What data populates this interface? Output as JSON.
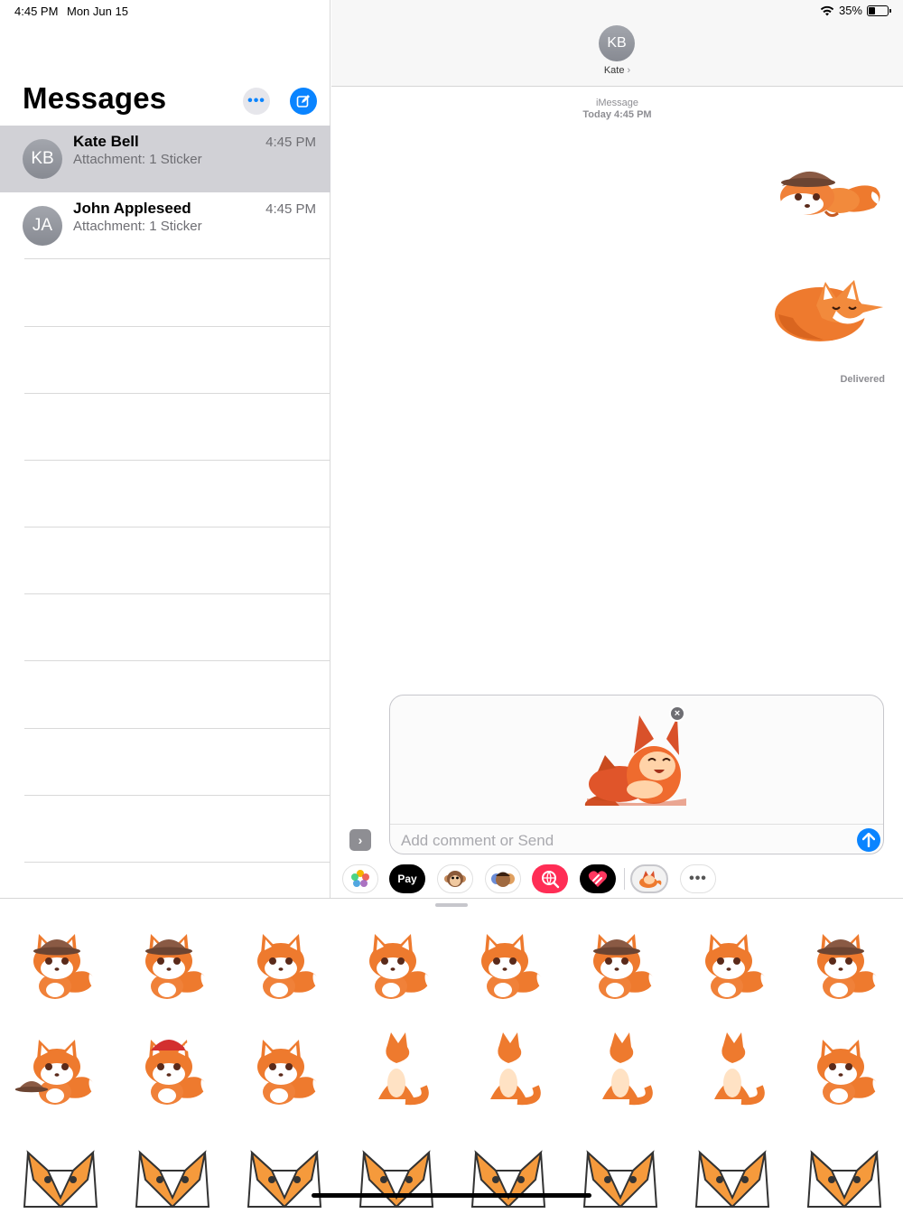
{
  "status": {
    "time": "4:45 PM",
    "date": "Mon Jun 15",
    "battery": "35%",
    "battery_level": 0.35
  },
  "list": {
    "title": "Messages",
    "conversations": [
      {
        "initials": "KB",
        "name": "Kate Bell",
        "preview": "Attachment: 1 Sticker",
        "time": "4:45 PM",
        "selected": true
      },
      {
        "initials": "JA",
        "name": "John Appleseed",
        "preview": "Attachment: 1 Sticker",
        "time": "4:45 PM",
        "selected": false
      }
    ]
  },
  "chat": {
    "contact_initials": "KB",
    "contact_name": "Kate",
    "service": "iMessage",
    "timestamp": "Today 4:45 PM",
    "status": "Delivered",
    "stickers": [
      "fox-detective-hat-icon",
      "fox-sleeping-curled-icon"
    ]
  },
  "compose": {
    "placeholder": "Add comment or Send",
    "attached_sticker": "fox-cat-hugging-icon",
    "remove_symbol": "×"
  },
  "apps": [
    "photos-icon",
    "apple-pay-icon",
    "animoji-icon",
    "memoji-icon",
    "web-search-icon",
    "digital-touch-icon",
    "fox-stickers-icon",
    "more-apps-icon"
  ],
  "apple_pay_label": "Pay",
  "colors": {
    "accent": "#0a84ff",
    "fox_orange": "#ee7a2e",
    "selected_row": "#d1d1d6"
  }
}
